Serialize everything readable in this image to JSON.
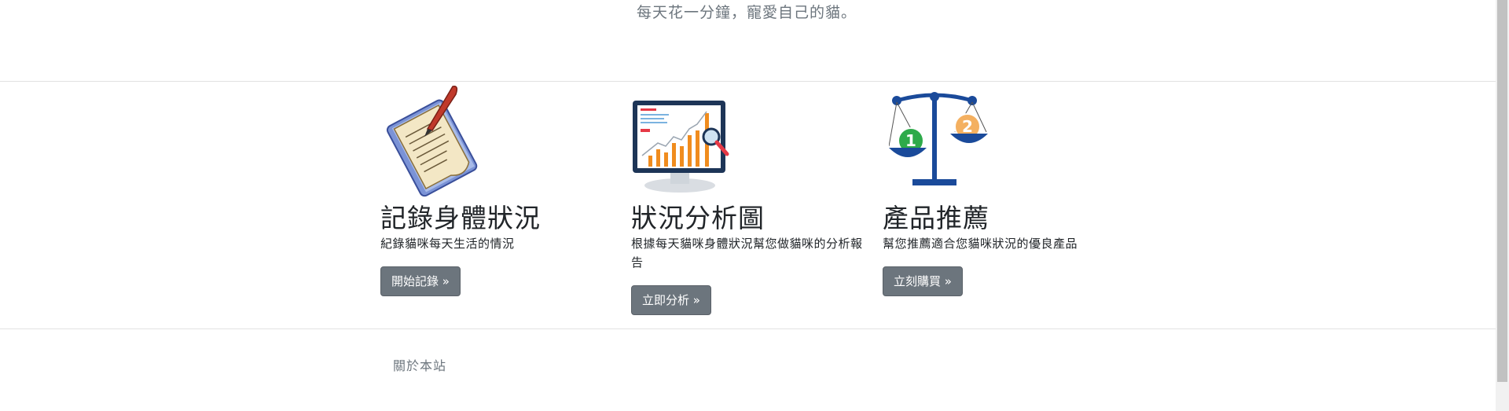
{
  "header": {
    "tagline": "每天花一分鐘，寵愛自己的貓。"
  },
  "features": [
    {
      "icon": "notebook-pen-icon",
      "title": "記錄身體狀況",
      "desc": "紀錄貓咪每天生活的情況",
      "button": "開始記錄 »"
    },
    {
      "icon": "chart-monitor-icon",
      "title": "狀況分析圖",
      "desc": "根據每天貓咪身體狀況幫您做貓咪的分析報告",
      "button": "立即分析 »"
    },
    {
      "icon": "balance-scale-icon",
      "title": "產品推薦",
      "desc": "幫您推薦適合您貓咪狀況的優良產品",
      "button": "立刻購買 »",
      "scale_labels": [
        "1",
        "2"
      ]
    }
  ],
  "footer": {
    "about": "關於本站"
  },
  "colors": {
    "button_bg": "#6c757d",
    "accent_green": "#2eaa4a",
    "accent_orange": "#f4b060",
    "accent_blue": "#1a4a9a"
  }
}
